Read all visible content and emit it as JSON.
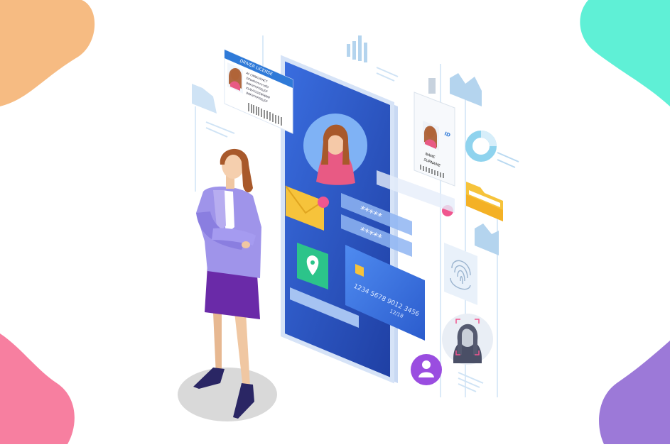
{
  "illustration": {
    "license_card": {
      "header": "DRIVER LICENSE",
      "lines": [
        "AF CMNKVDNCT",
        "DKwdhhmnvcdfd",
        "BNKVFHFKKLJDF",
        "KLNVFCGGWHJNN",
        "BNKVFHFKKLJDF"
      ]
    },
    "id_badge": {
      "tag": "ID",
      "name_lines": [
        "NAME",
        "SURNAME"
      ]
    },
    "credit_card": {
      "number": "1234 5678 9012 3456",
      "expiry": "12/18"
    },
    "password_fields": [
      "*****",
      "*****"
    ],
    "colors": {
      "phone_blue": "#2a55bd",
      "accent_pink": "#f0568f",
      "accent_purple": "#9a4de0",
      "suit_lavender": "#9f94ea",
      "skirt_purple": "#6a2aa8",
      "folder_yellow": "#f6c33b",
      "blob_peach": "#f6bb82",
      "blob_mint": "#5ff0d6",
      "blob_pink": "#f77fa0",
      "blob_violet": "#9c79d8"
    },
    "icons": [
      "license-card-icon",
      "id-badge-icon",
      "envelope-icon",
      "location-pin-icon",
      "credit-card-icon",
      "folder-icon",
      "donut-chart-icon",
      "fingerprint-icon",
      "face-scan-icon",
      "user-profile-icon"
    ]
  }
}
